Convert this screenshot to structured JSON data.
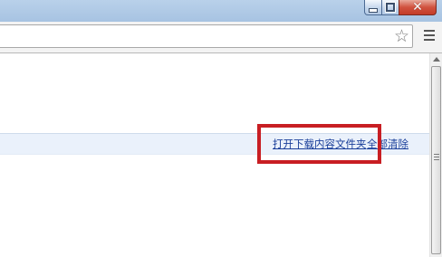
{
  "window": {
    "controls": {
      "minimize_icon": "minimize-icon",
      "maximize_icon": "restore-icon",
      "close_icon": "close-icon",
      "close_glyph": "✕"
    }
  },
  "toolbar": {
    "address_value": "",
    "star_glyph": "☆",
    "menu_icon": "hamburger-menu-icon"
  },
  "downloads": {
    "open_folder_link": "打开下载内容文件夹",
    "clear_all_link": "全部清除"
  },
  "annotation": {
    "highlight_color": "#c81e23"
  },
  "colors": {
    "titlebar": "#b9d1ea",
    "close_button": "#c43c28",
    "link": "#1a3f9a",
    "downloads_bar": "#eaf1fb"
  }
}
